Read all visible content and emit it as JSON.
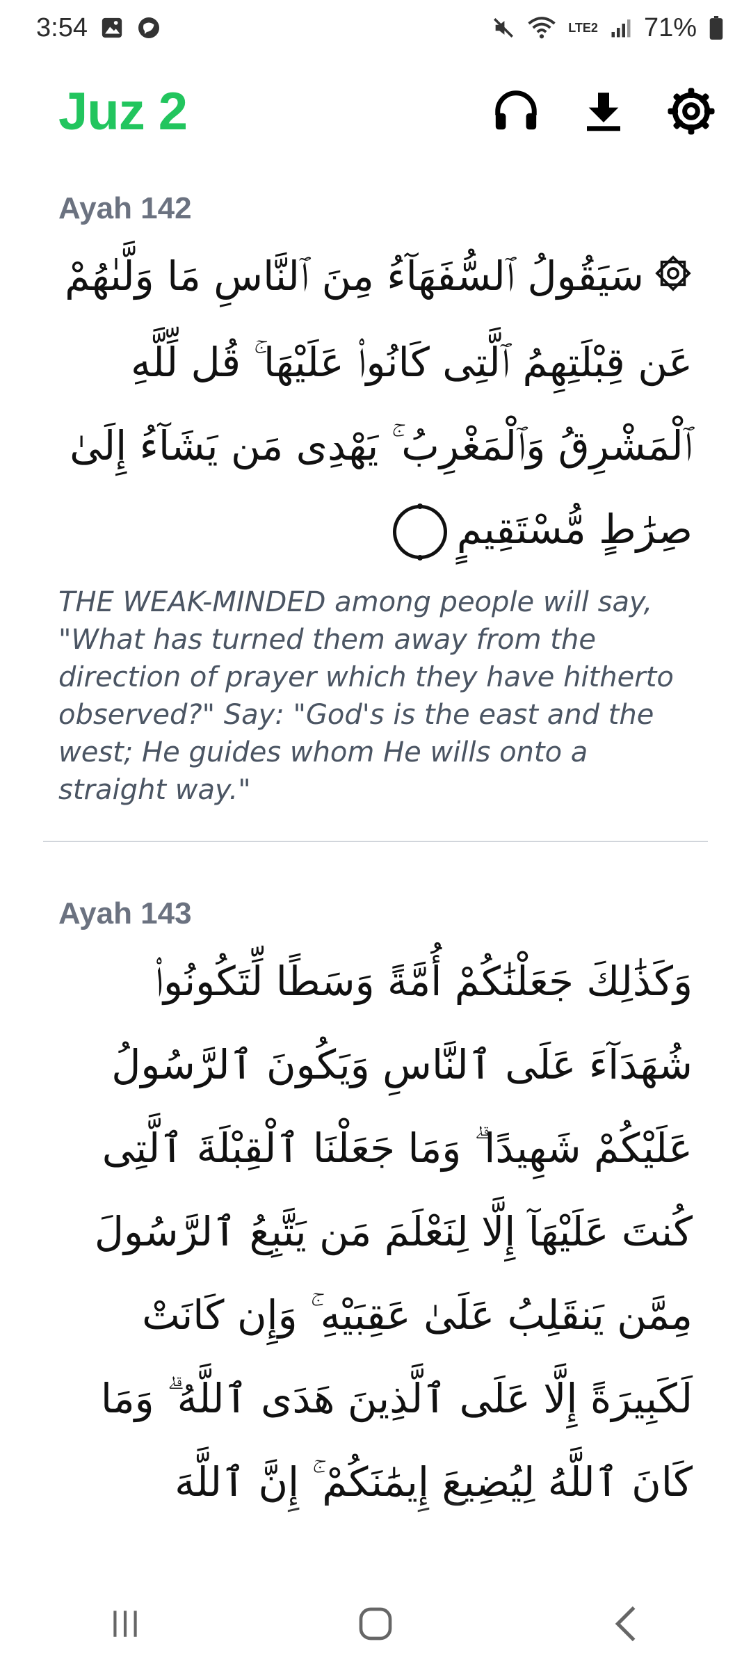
{
  "status_bar": {
    "time": "3:54",
    "battery": "71%",
    "network": "LTE2"
  },
  "header": {
    "title": "Juz 2",
    "icons": [
      "headphones-icon",
      "download-icon",
      "settings-gear-icon"
    ],
    "accent_color": "#22c55e"
  },
  "ayahs": [
    {
      "label": "Ayah 142",
      "arabic": "سَيَقُولُ ٱلسُّفَهَآءُ مِنَ ٱلنَّاسِ مَا وَلَّىٰهُمْ عَن قِبْلَتِهِمُ ٱلَّتِى كَانُوا۟ عَلَيْهَا ۚ قُل لِّلَّهِ ٱلْمَشْرِقُ وَٱلْمَغْرِبُ ۚ يَهْدِى مَن يَشَآءُ إِلَىٰ صِرَٰطٍ مُّسْتَقِيمٍ",
      "translation": "THE WEAK-MINDED among people will say, \"What has turned them away from the direction of prayer which they have hitherto observed?\" Say: \"God's is the east and the west; He guides whom He wills onto a straight way.\""
    },
    {
      "label": "Ayah 143",
      "arabic": "وَكَذَٰلِكَ جَعَلْنَٰكُمْ أُمَّةً وَسَطًا لِّتَكُونُوا۟ شُهَدَآءَ عَلَى ٱلنَّاسِ وَيَكُونَ ٱلرَّسُولُ عَلَيْكُمْ شَهِيدًا ۗ وَمَا جَعَلْنَا ٱلْقِبْلَةَ ٱلَّتِى كُنتَ عَلَيْهَآ إِلَّا لِنَعْلَمَ مَن يَتَّبِعُ ٱلرَّسُولَ مِمَّن يَنقَلِبُ عَلَىٰ عَقِبَيْهِ ۚ وَإِن كَانَتْ لَكَبِيرَةً إِلَّا عَلَى ٱلَّذِينَ هَدَى ٱللَّهُ ۗ وَمَا كَانَ ٱللَّهُ لِيُضِيعَ إِيمَٰنَكُمْ ۚ إِنَّ ٱللَّهَ"
    }
  ],
  "nav_bar": {
    "icons": [
      "recent-apps-icon",
      "home-icon",
      "back-icon"
    ]
  }
}
